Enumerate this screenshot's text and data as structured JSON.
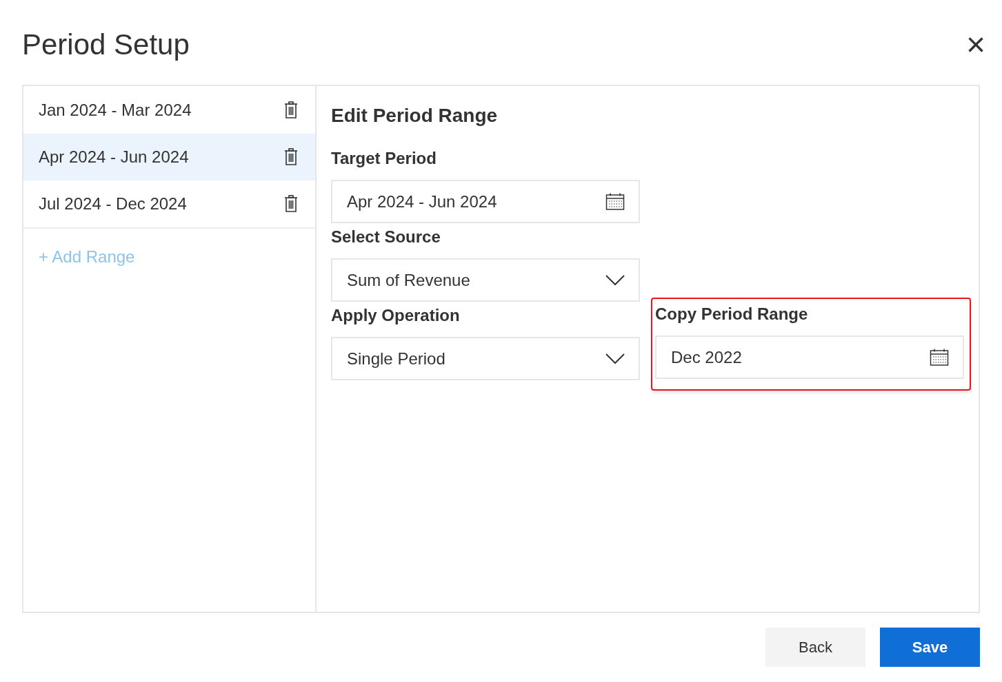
{
  "dialog": {
    "title": "Period Setup",
    "close": "×"
  },
  "ranges": [
    {
      "label": "Jan 2024 - Mar 2024",
      "selected": false
    },
    {
      "label": "Apr 2024 - Jun 2024",
      "selected": true
    },
    {
      "label": "Jul 2024 - Dec 2024",
      "selected": false
    }
  ],
  "add_range": "+ Add Range",
  "editor": {
    "heading": "Edit Period Range",
    "fields": [
      {
        "label": "Target Period",
        "value": "Apr 2024 - Jun 2024",
        "kind": "date"
      },
      {
        "label": "Select Source",
        "value": "Sum of Revenue",
        "kind": "select"
      },
      {
        "label": "Apply Operation",
        "value": "Single Period",
        "kind": "select"
      }
    ],
    "copy_field": {
      "label": "Copy Period Range",
      "value": "Dec 2022",
      "kind": "date",
      "highlighted": true
    }
  },
  "buttons": [
    {
      "label": "Back",
      "kind": "secondary"
    },
    {
      "label": "Save",
      "kind": "primary"
    }
  ]
}
